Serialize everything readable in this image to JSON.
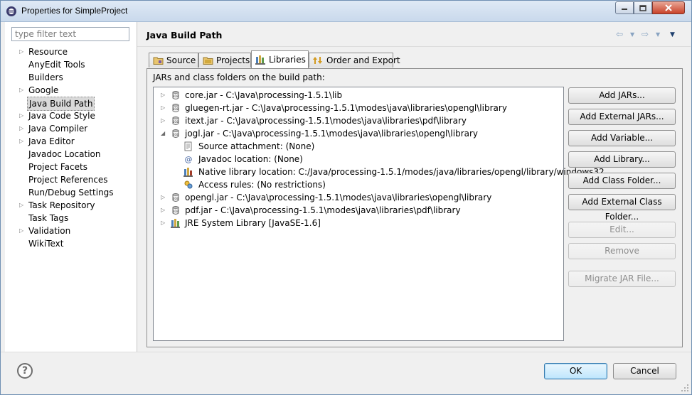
{
  "window": {
    "title": "Properties for SimpleProject",
    "min_icon": "minimize-icon",
    "max_icon": "maximize-icon",
    "close_icon": "close-icon"
  },
  "filter": {
    "placeholder": "type filter text"
  },
  "nav": {
    "items": [
      {
        "label": "Resource",
        "expandable": true
      },
      {
        "label": "AnyEdit Tools",
        "expandable": false
      },
      {
        "label": "Builders",
        "expandable": false
      },
      {
        "label": "Google",
        "expandable": true
      },
      {
        "label": "Java Build Path",
        "expandable": false,
        "selected": true
      },
      {
        "label": "Java Code Style",
        "expandable": true
      },
      {
        "label": "Java Compiler",
        "expandable": true
      },
      {
        "label": "Java Editor",
        "expandable": true
      },
      {
        "label": "Javadoc Location",
        "expandable": false
      },
      {
        "label": "Project Facets",
        "expandable": false
      },
      {
        "label": "Project References",
        "expandable": false
      },
      {
        "label": "Run/Debug Settings",
        "expandable": false
      },
      {
        "label": "Task Repository",
        "expandable": true
      },
      {
        "label": "Task Tags",
        "expandable": false
      },
      {
        "label": "Validation",
        "expandable": true
      },
      {
        "label": "WikiText",
        "expandable": false
      }
    ]
  },
  "page": {
    "title": "Java Build Path",
    "tabs": [
      {
        "label": "Source",
        "icon": "source-folder-icon"
      },
      {
        "label": "Projects",
        "icon": "projects-folder-icon"
      },
      {
        "label": "Libraries",
        "icon": "libraries-icon",
        "active": true
      },
      {
        "label": "Order and Export",
        "icon": "order-export-icon"
      }
    ],
    "panel_label": "JARs and class folders on the build path:",
    "entries": [
      {
        "text": "core.jar - C:\\Java\\processing-1.5.1\\lib",
        "icon": "jar-icon",
        "level": 0,
        "expander": "collapsed"
      },
      {
        "text": "gluegen-rt.jar - C:\\Java\\processing-1.5.1\\modes\\java\\libraries\\opengl\\library",
        "icon": "jar-icon",
        "level": 0,
        "expander": "collapsed"
      },
      {
        "text": "itext.jar - C:\\Java\\processing-1.5.1\\modes\\java\\libraries\\pdf\\library",
        "icon": "jar-icon",
        "level": 0,
        "expander": "collapsed"
      },
      {
        "text": "jogl.jar - C:\\Java\\processing-1.5.1\\modes\\java\\libraries\\opengl\\library",
        "icon": "jar-icon",
        "level": 0,
        "expander": "expanded"
      },
      {
        "text": "Source attachment: (None)",
        "icon": "source-attachment-icon",
        "level": 1,
        "expander": "none"
      },
      {
        "text": "Javadoc location: (None)",
        "icon": "javadoc-icon",
        "level": 1,
        "expander": "none"
      },
      {
        "text": "Native library location: C:/Java/processing-1.5.1/modes/java/libraries/opengl/library/windows32",
        "icon": "native-library-icon",
        "level": 1,
        "expander": "none"
      },
      {
        "text": "Access rules: (No restrictions)",
        "icon": "access-rules-icon",
        "level": 1,
        "expander": "none"
      },
      {
        "text": "opengl.jar - C:\\Java\\processing-1.5.1\\modes\\java\\libraries\\opengl\\library",
        "icon": "jar-icon",
        "level": 0,
        "expander": "collapsed"
      },
      {
        "text": "pdf.jar - C:\\Java\\processing-1.5.1\\modes\\java\\libraries\\pdf\\library",
        "icon": "jar-icon",
        "level": 0,
        "expander": "collapsed"
      },
      {
        "text": "JRE System Library [JavaSE-1.6]",
        "icon": "jre-library-icon",
        "level": 0,
        "expander": "collapsed"
      }
    ],
    "buttons": [
      {
        "label": "Add JARs...",
        "enabled": true
      },
      {
        "label": "Add External JARs...",
        "enabled": true
      },
      {
        "label": "Add Variable...",
        "enabled": true
      },
      {
        "label": "Add Library...",
        "enabled": true
      },
      {
        "label": "Add Class Folder...",
        "enabled": true
      },
      {
        "label": "Add External Class Folder...",
        "enabled": true
      },
      {
        "label": "Edit...",
        "enabled": false
      },
      {
        "label": "Remove",
        "enabled": false
      },
      {
        "label": "Migrate JAR File...",
        "enabled": false
      }
    ]
  },
  "footer": {
    "ok_label": "OK",
    "cancel_label": "Cancel",
    "help_icon": "help-icon"
  }
}
